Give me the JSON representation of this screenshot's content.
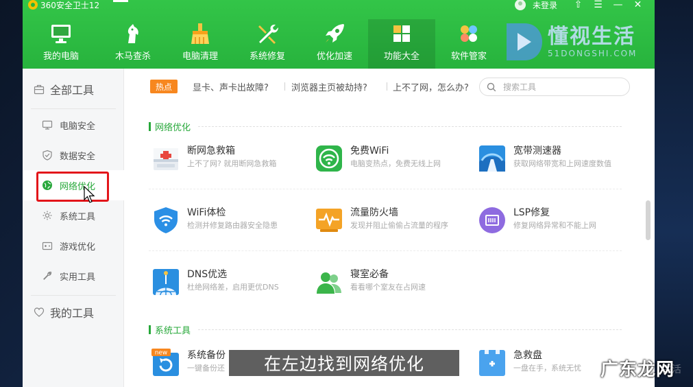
{
  "app": {
    "title": "360安全卫士12",
    "login": "未登录",
    "controls": [
      "⇧",
      "☰",
      "—",
      "✕"
    ]
  },
  "nav": {
    "items": [
      {
        "label": "我的电脑",
        "icon": "computer-icon"
      },
      {
        "label": "木马查杀",
        "icon": "horse-icon"
      },
      {
        "label": "电脑清理",
        "icon": "broom-icon"
      },
      {
        "label": "系统修复",
        "icon": "wrench-icon"
      },
      {
        "label": "优化加速",
        "icon": "rocket-icon"
      },
      {
        "label": "功能大全",
        "icon": "grid-icon",
        "active": true
      },
      {
        "label": "软件管家",
        "icon": "apps-icon"
      }
    ]
  },
  "watermark": {
    "title": "懂视生活",
    "subtitle": "51DONGSHI.COM"
  },
  "sidebar": {
    "all_tools": "全部工具",
    "items": [
      {
        "label": "电脑安全",
        "icon": "monitor-icon"
      },
      {
        "label": "数据安全",
        "icon": "shield-check-icon"
      },
      {
        "label": "网络优化",
        "icon": "globe-icon",
        "active": true
      },
      {
        "label": "系统工具",
        "icon": "gear-icon"
      },
      {
        "label": "游戏优化",
        "icon": "gamepad-icon"
      },
      {
        "label": "实用工具",
        "icon": "tool-icon"
      }
    ],
    "my_tools": "我的工具"
  },
  "hot": {
    "badge": "热点",
    "links": [
      "显卡、声卡出故障?",
      "浏览器主页被劫持?",
      "上不了网，怎么办?"
    ]
  },
  "search": {
    "placeholder": "搜索工具"
  },
  "sections": [
    {
      "title": "网络优化",
      "tools": [
        {
          "name": "断网急救箱",
          "desc": "上不了网? 就用断网急救箱"
        },
        {
          "name": "免费WiFi",
          "desc": "电脑变热点，免费无线上网"
        },
        {
          "name": "宽带测速器",
          "desc": "获取网络带宽和上网速度数值"
        },
        {
          "name": "WiFi体检",
          "desc": "检测并修复路由器安全隐患"
        },
        {
          "name": "流量防火墙",
          "desc": "发现并阻止偷偷占流量的程序"
        },
        {
          "name": "LSP修复",
          "desc": "修复网络异常和不能上网"
        },
        {
          "name": "DNS优选",
          "desc": "杜绝网络差，启用更优DNS"
        },
        {
          "name": "寝室必备",
          "desc": "看看哪个室友在占网速"
        }
      ]
    },
    {
      "title": "系统工具",
      "tools": [
        {
          "name": "系统备份",
          "desc": "一键备份还",
          "badge": "new"
        },
        {
          "name": "急救盘",
          "desc": "一盘在手，系统无忧"
        }
      ]
    }
  ],
  "subtitle": "在左边找到网络优化",
  "corner_watermark": {
    "title": "广东龙网",
    "subtitle": "生活"
  }
}
